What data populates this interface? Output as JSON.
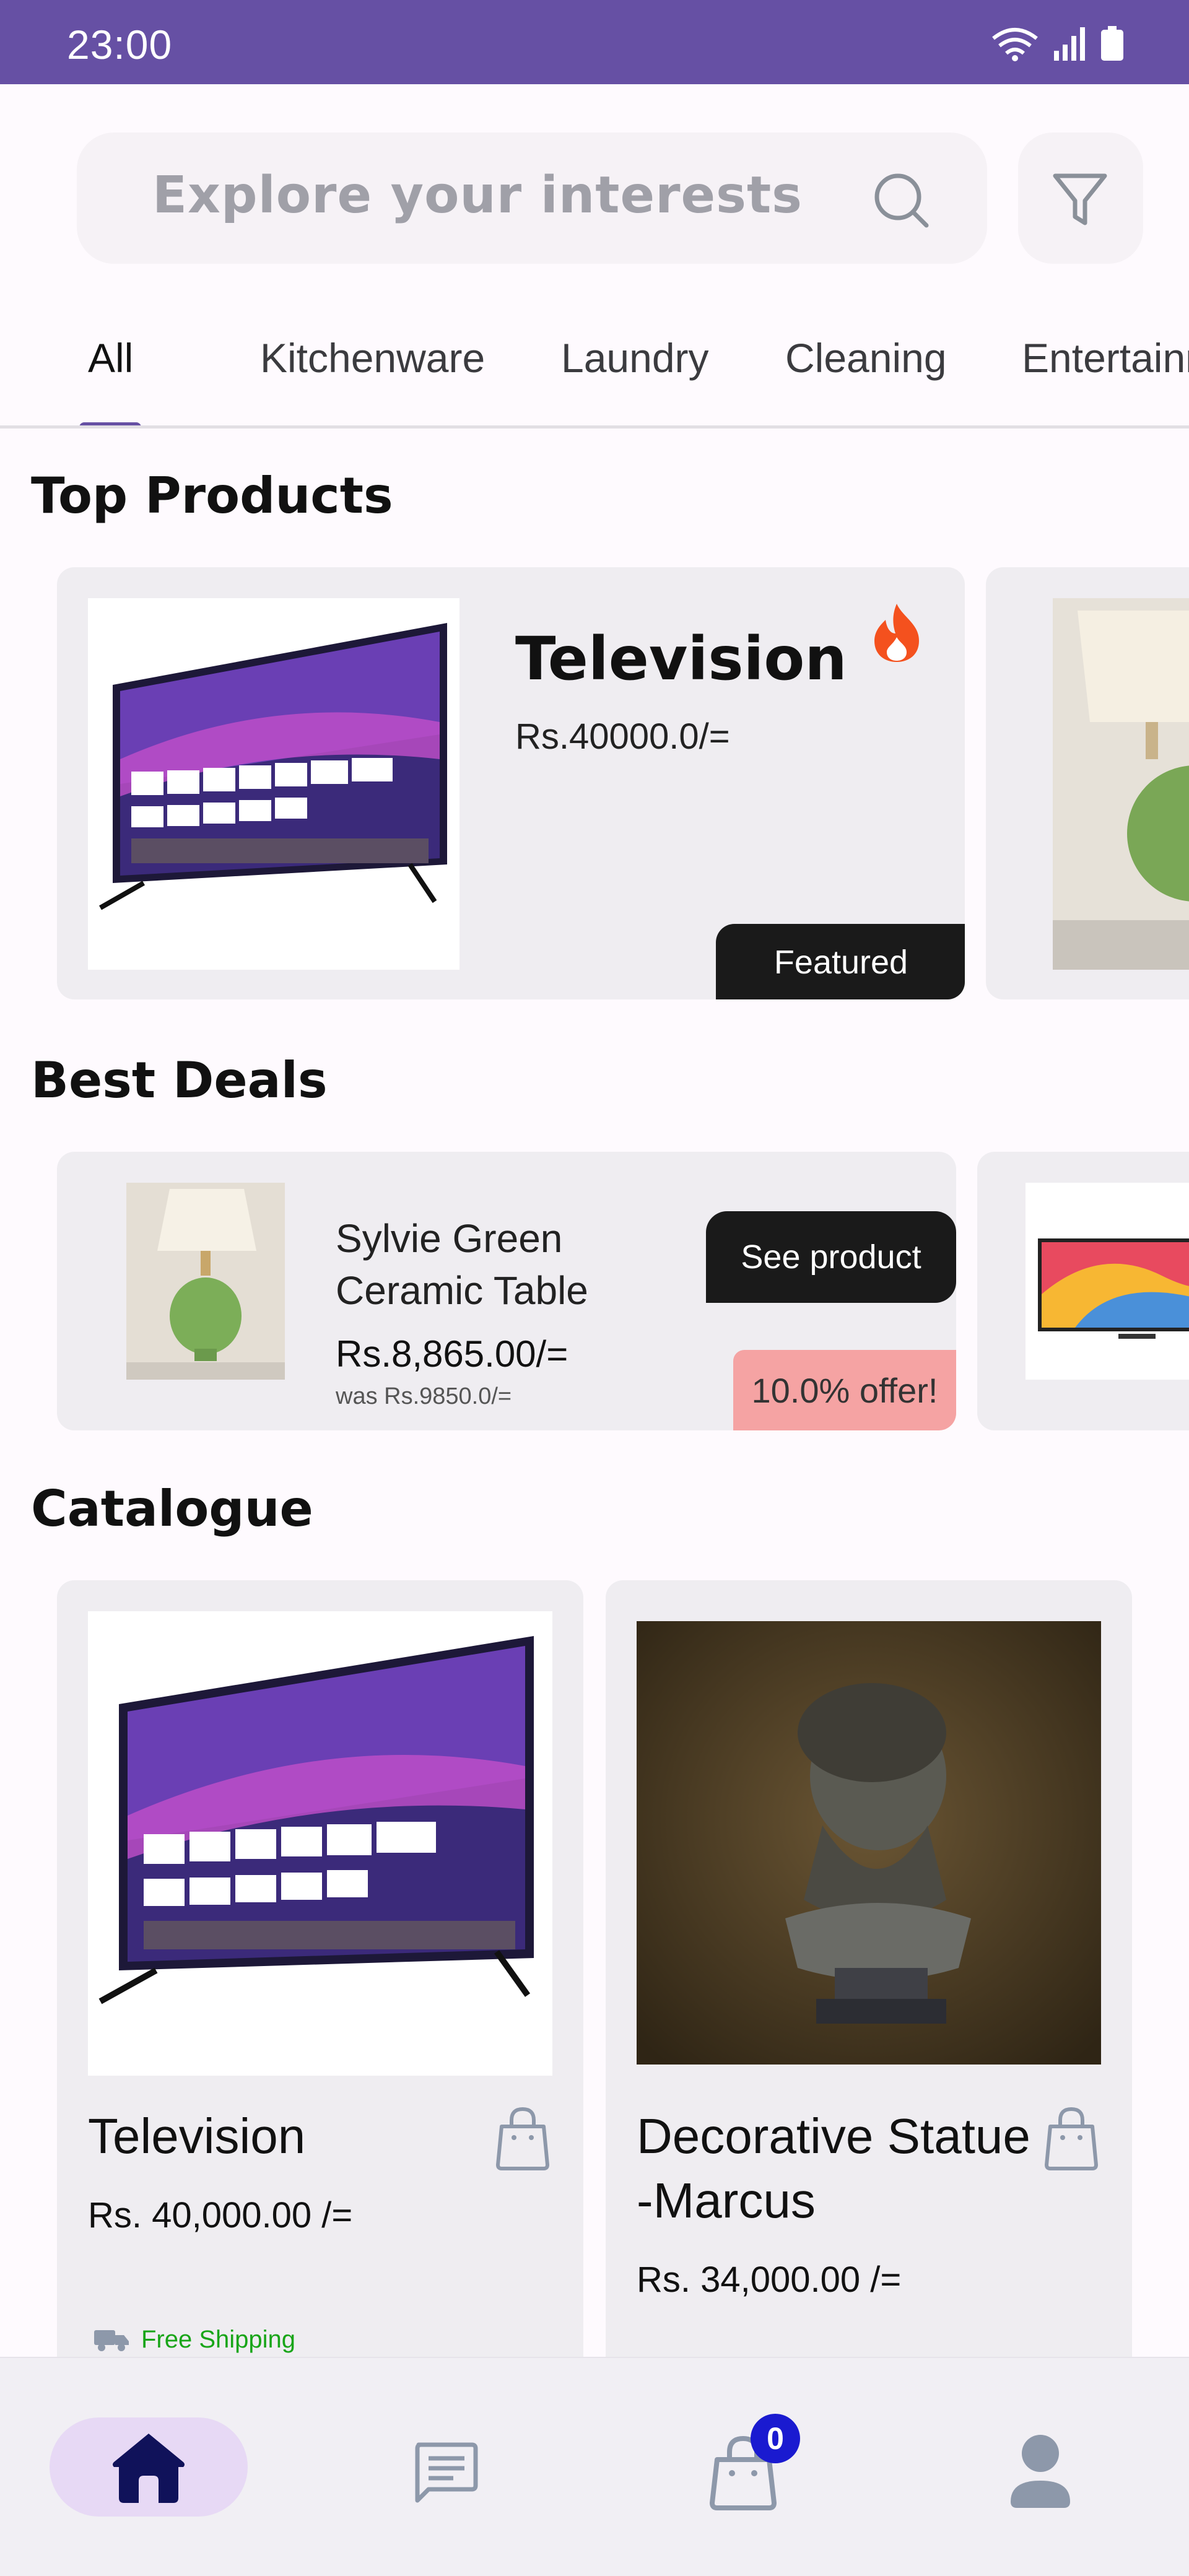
{
  "status_bar": {
    "time": "23:00"
  },
  "search": {
    "placeholder": "Explore your interests"
  },
  "tabs": [
    "All",
    "Kitchenware",
    "Laundry",
    "Cleaning",
    "Entertainm"
  ],
  "sections": {
    "top_products": "Top Products",
    "best_deals": "Best Deals",
    "catalogue": "Catalogue"
  },
  "top_product": {
    "name": "Television",
    "price": "Rs.40000.0/=",
    "badge": "Featured"
  },
  "best_deal": {
    "name": "Sylvie Green Ceramic Table",
    "price": "Rs.8,865.00/=",
    "was": "was Rs.9850.0/=",
    "cta": "See product",
    "offer": "10.0% offer!"
  },
  "catalogue": [
    {
      "name": "Television",
      "price": "Rs. 40,000.00 /=",
      "shipping": "Free Shipping"
    },
    {
      "name": "Decorative Statue -Marcus",
      "price": "Rs. 34,000.00 /="
    }
  ],
  "bottom_nav": {
    "cart_count": "0"
  },
  "colors": {
    "primary": "#6650a4",
    "dark": "#1a1a1a",
    "offer": "#f5a3a3",
    "fire": "#f4511e",
    "free_shipping": "#18a518"
  },
  "icons": [
    "wifi-icon",
    "signal-icon",
    "battery-icon",
    "search-icon",
    "filter-icon",
    "fire-icon",
    "bag-icon",
    "truck-icon",
    "home-icon",
    "chat-icon",
    "cart-icon",
    "profile-icon"
  ]
}
